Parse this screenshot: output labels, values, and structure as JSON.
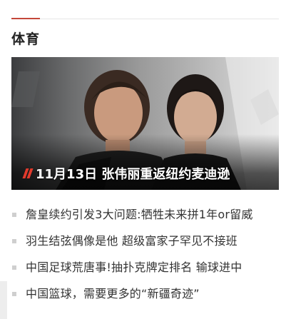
{
  "colors": {
    "accent": "#c4473a",
    "hero_slash": "#e23a2c",
    "text": "#333333",
    "title": "#222222",
    "bullet": "#cfcfcf"
  },
  "section": {
    "title": "体育"
  },
  "hero": {
    "title": "11月13日 张伟丽重返纽约麦迪逊",
    "icon": "slash-icon"
  },
  "news": [
    {
      "title": "詹皇续约引发3大问题:牺牲未来拼1年or留威"
    },
    {
      "title": "羽生结弦偶像是他 超级富家子罕见不接班"
    },
    {
      "title": "中国足球荒唐事!抽扑克牌定排名 输球进中"
    },
    {
      "title": "中国篮球，需要更多的“新疆奇迹”"
    }
  ]
}
